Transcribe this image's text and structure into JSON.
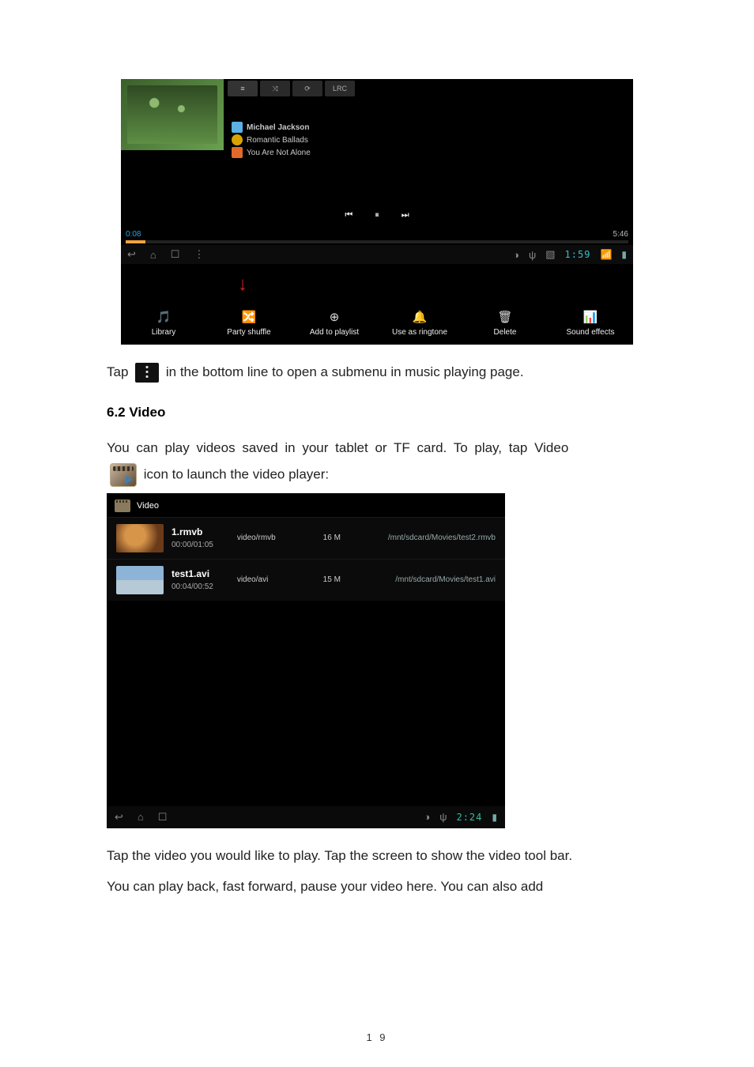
{
  "music": {
    "tabs": {
      "t1": "≡",
      "t2": "⤨",
      "t3": "⟳",
      "t4": "LRC"
    },
    "artist": "Michael Jackson",
    "album": "Romantic Ballads",
    "track": "You Are Not Alone",
    "time_elapsed": "0:08",
    "time_total": "5:46",
    "transport": {
      "prev": "⏮",
      "pause": "⏸",
      "next": "⏭"
    },
    "status_clock": "1:59",
    "submenu": {
      "library": "Library",
      "party": "Party shuffle",
      "add": "Add to playlist",
      "ring": "Use as ringtone",
      "del": "Delete",
      "fx": "Sound effects"
    }
  },
  "para1a": "Tap ",
  "para1b": " in the bottom line to open a submenu in music playing page.",
  "heading": "6.2 Video",
  "para2": "You can play videos saved in your tablet or TF card. To play, tap Video",
  "para3": "icon to launch the video player:",
  "videolist": {
    "title": "Video",
    "rows": [
      {
        "name": "1.rmvb",
        "dur": "00:00/01:05",
        "mime": "video/rmvb",
        "size": "16 M",
        "path": "/mnt/sdcard/Movies/test2.rmvb"
      },
      {
        "name": "test1.avi",
        "dur": "00:04/00:52",
        "mime": "video/avi",
        "size": "15 M",
        "path": "/mnt/sdcard/Movies/test1.avi"
      }
    ],
    "clock": "2:24"
  },
  "para4": "Tap the video you would like to play. Tap the screen to show the video tool bar.",
  "para5": "You can play back, fast forward, pause your video here. You can also add",
  "page_number": "1 9"
}
